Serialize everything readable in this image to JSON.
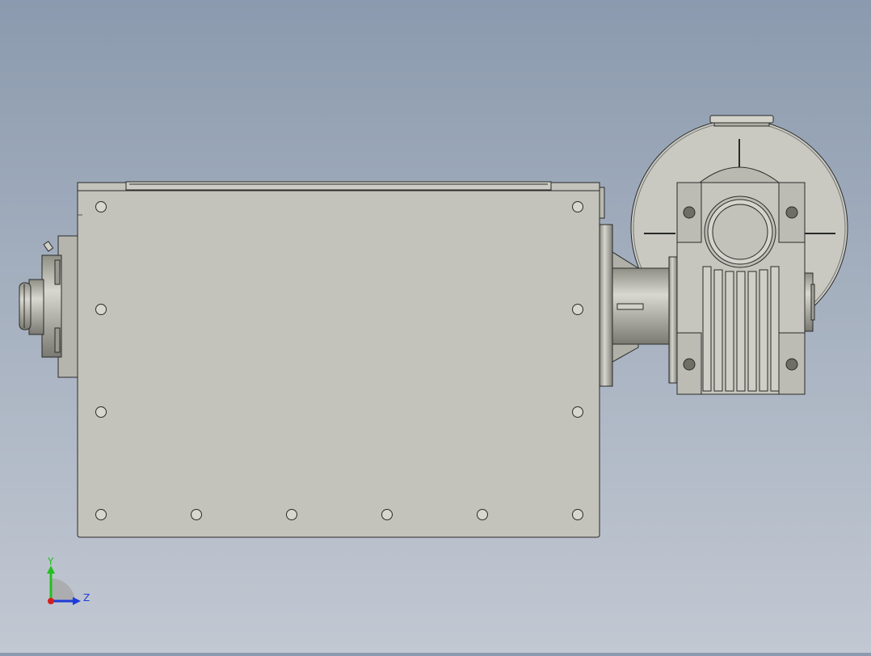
{
  "viewport": {
    "view_orientation": "front",
    "background_top": "#8b9aae",
    "background_bottom": "#c2c8d2",
    "part_fill": "#c3c3bb",
    "part_stroke": "#2a2a2a"
  },
  "triad": {
    "y_label": "Y",
    "z_label": "Z",
    "y_color": "#22c01e",
    "z_color": "#1f3cd8",
    "x_color": "#d41f1f"
  },
  "model": {
    "components": [
      "base-plate",
      "left-bearing-housing",
      "shaft-coupling",
      "worm-gearbox",
      "motor-flange"
    ]
  }
}
